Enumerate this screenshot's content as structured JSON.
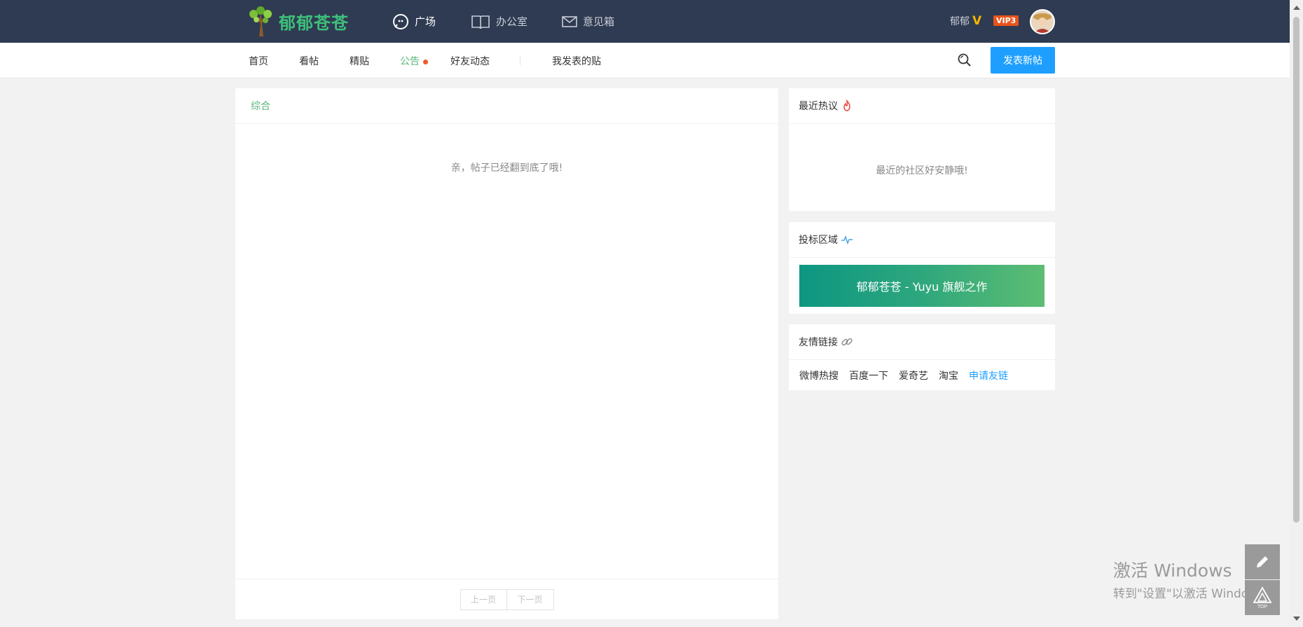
{
  "app": {
    "name": "郁郁苍苍"
  },
  "topnav": [
    {
      "label": "广场",
      "icon": "chat-bubble-icon",
      "active": true
    },
    {
      "label": "办公室",
      "icon": "book-icon",
      "active": false
    },
    {
      "label": "意见箱",
      "icon": "mail-icon",
      "active": false
    }
  ],
  "user": {
    "name": "郁郁",
    "badge": "V",
    "vip": "VIP3"
  },
  "subnav": {
    "items": [
      "首页",
      "看帖",
      "精贴",
      "公告",
      "好友动态",
      "我发表的贴"
    ],
    "post_button": "发表新帖"
  },
  "main": {
    "tab": "综合",
    "empty_message": "亲，帖子已经翻到底了哦!",
    "pager": {
      "prev": "上一页",
      "next": "下一页"
    }
  },
  "sidebar": {
    "hot": {
      "title": "最近热议",
      "message": "最近的社区好安静哦!"
    },
    "ad": {
      "title": "投标区域",
      "banner": "郁郁苍苍 - Yuyu 旗舰之作"
    },
    "links": {
      "title": "友情链接",
      "items": [
        "微博热搜",
        "百度一下",
        "爱奇艺",
        "淘宝"
      ],
      "apply": "申请友链"
    }
  },
  "fab": {
    "top_label": "TOP"
  },
  "watermark": {
    "line1": "激活 Windows",
    "line2": "转到\"设置\"以激活 Windows。"
  },
  "colors": {
    "header_bg": "#2f3b52",
    "accent_green": "#5bb47b",
    "primary_blue": "#1e9fff",
    "vip_orange": "#e9541c"
  }
}
